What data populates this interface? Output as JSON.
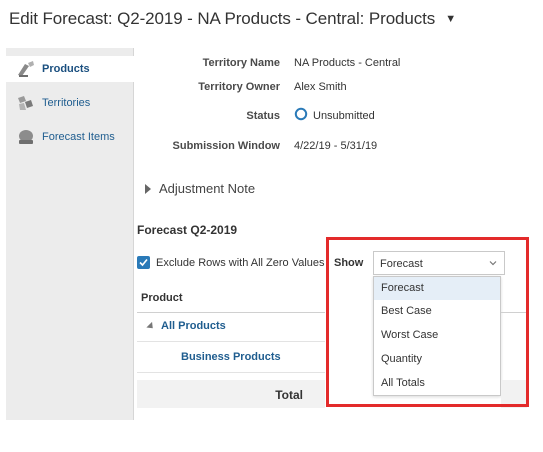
{
  "page": {
    "title": "Edit Forecast: Q2-2019 - NA Products - Central: Products",
    "title_caret": "▼"
  },
  "sidebar": {
    "items": [
      {
        "label": "Products",
        "icon": "products-icon",
        "active": true
      },
      {
        "label": "Territories",
        "icon": "territories-icon",
        "active": false
      },
      {
        "label": "Forecast Items",
        "icon": "forecast-items-icon",
        "active": false
      }
    ]
  },
  "details": {
    "territory_name_label": "Territory Name",
    "territory_name_value": "NA Products - Central",
    "territory_owner_label": "Territory Owner",
    "territory_owner_value": "Alex Smith",
    "status_label": "Status",
    "status_value": "Unsubmitted",
    "submission_window_label": "Submission Window",
    "submission_window_value": "4/22/19 - 5/31/19"
  },
  "adjustment_note": "Adjustment Note",
  "forecast": {
    "section_title": "Forecast Q2-2019",
    "exclude_zero_label": "Exclude Rows with All Zero Values",
    "exclude_zero_checked": true,
    "show_label": "Show",
    "show_selected": "Forecast",
    "show_options": [
      "Forecast",
      "Best Case",
      "Worst Case",
      "Quantity",
      "All Totals"
    ]
  },
  "table": {
    "column_header": "Product",
    "rows": [
      {
        "label": "All Products"
      },
      {
        "label": "Business Products"
      }
    ],
    "total_label": "Total"
  },
  "colors": {
    "accent": "#2a7ab8",
    "link": "#1f5d8f",
    "highlight": "#e32a2a"
  }
}
